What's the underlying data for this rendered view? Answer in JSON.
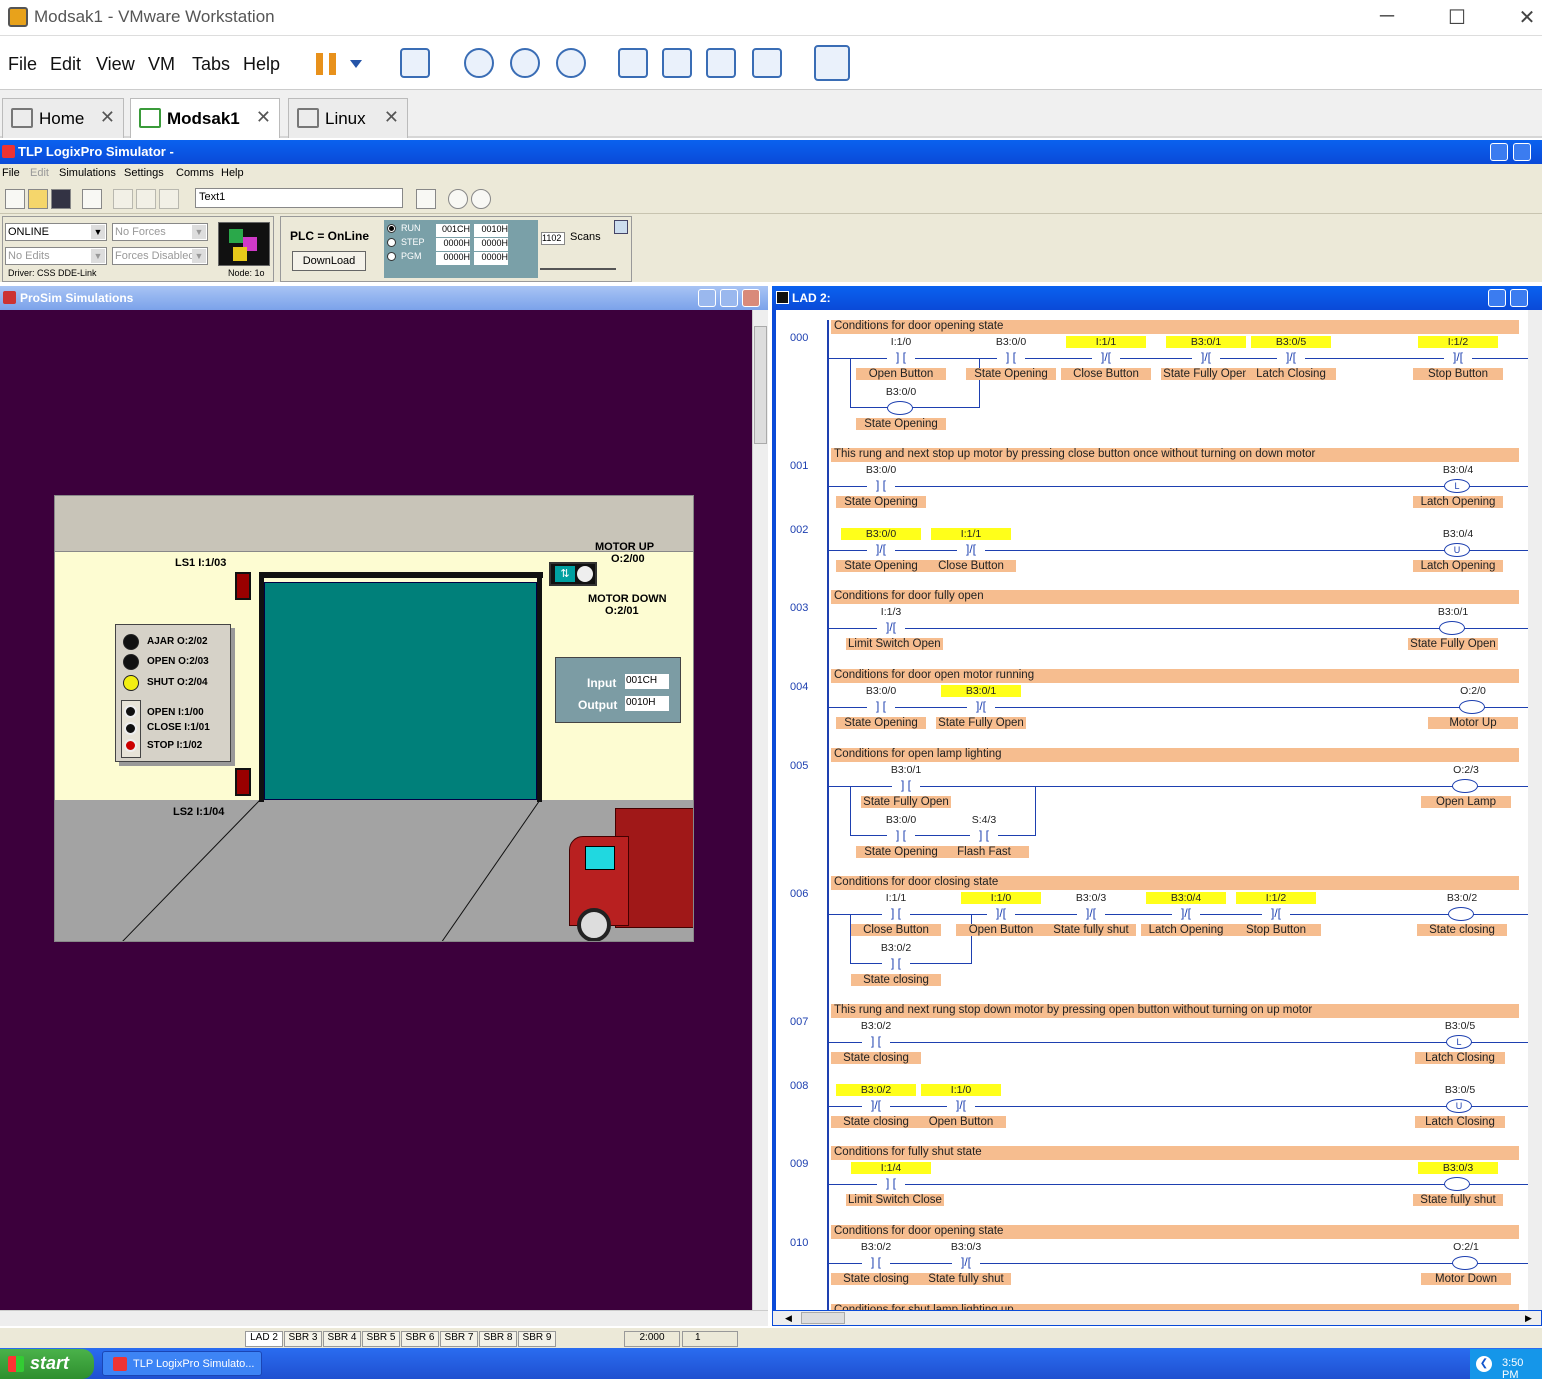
{
  "vm": {
    "title": "Modsak1 - VMware Workstation",
    "menu": [
      "File",
      "Edit",
      "View",
      "VM",
      "Tabs",
      "Help"
    ],
    "tabs": [
      {
        "label": "Home",
        "active": false
      },
      {
        "label": "Modsak1",
        "active": true
      },
      {
        "label": "Linux",
        "active": false
      }
    ]
  },
  "tlp": {
    "title": "TLP LogixPro Simulator  -",
    "menu": [
      "File",
      "Edit",
      "Simulations",
      "Settings",
      "Comms",
      "Help"
    ],
    "text_field": "Text1",
    "mode_select": "ONLINE",
    "forces_select": "No Forces",
    "edits_select": "No Edits",
    "forces_disabled_select": "Forces Disabled",
    "driver": "Driver: CSS DDE-Link",
    "node": "Node: 1o",
    "plc_status": "PLC = OnLine",
    "download_label": "DownLoad",
    "run_modes": [
      "RUN",
      "STEP",
      "PGM"
    ],
    "io_values": [
      "001CH",
      "0010H",
      "0000H",
      "0000H",
      "0000H",
      "0000H"
    ],
    "scan_count": "1102",
    "scan_label": "Scans"
  },
  "prosim": {
    "title": "ProSim Simulations",
    "ls1": "LS1  I:1/03",
    "ls2": "LS2   I:1/04",
    "motor_up": "MOTOR UP",
    "motor_up_addr": "O:2/00",
    "motor_down": "MOTOR DOWN",
    "motor_down_addr": "O:2/01",
    "lamps": [
      {
        "label": "AJAR  O:2/02",
        "color": "#111111"
      },
      {
        "label": "OPEN  O:2/03",
        "color": "#111111"
      },
      {
        "label": "SHUT  O:2/04",
        "color": "#f2ee12"
      }
    ],
    "buttons": [
      "OPEN    I:1/00",
      "CLOSE I:1/01",
      "STOP   I:1/02"
    ],
    "input_label": "Input",
    "input_value": "001CH",
    "output_label": "Output",
    "output_value": "0010H"
  },
  "lad": {
    "title": "LAD 2:",
    "rungs": [
      {
        "num": "000",
        "comment": "Conditions for door opening state"
      },
      {
        "num": "001",
        "comment": "This rung and next stop up motor by pressing close button once without turning on down motor"
      },
      {
        "num": "002",
        "comment": ""
      },
      {
        "num": "003",
        "comment": "Conditions for door fully open"
      },
      {
        "num": "004",
        "comment": "Conditions for door open motor running"
      },
      {
        "num": "005",
        "comment": "Conditions for open lamp lighting"
      },
      {
        "num": "006",
        "comment": "Conditions for door closing state"
      },
      {
        "num": "007",
        "comment": "This rung and next rung stop down motor by pressing open button without turning on up motor"
      },
      {
        "num": "008",
        "comment": ""
      },
      {
        "num": "009",
        "comment": "Conditions for fully shut state"
      },
      {
        "num": "010",
        "comment": "Conditions for door opening state"
      },
      {
        "num": "",
        "comment": "Conditions for shut lamp lighting up"
      }
    ],
    "elements": [
      {
        "addr": "I:1/0",
        "desc": "Open Button",
        "glyph": "] [",
        "hl": false
      },
      {
        "addr": "B3:0/0",
        "desc": "State Opening",
        "glyph": "] [",
        "hl": false
      },
      {
        "addr": "I:1/1",
        "desc": "Close Button",
        "glyph": "]/[",
        "hl": true
      },
      {
        "addr": "B3:0/1",
        "desc": "State Fully Open",
        "glyph": "]/[",
        "hl": true
      },
      {
        "addr": "B3:0/5",
        "desc": "Latch Closing",
        "glyph": "]/[",
        "hl": true
      },
      {
        "addr": "I:1/2",
        "desc": "Stop Button",
        "glyph": "]/[",
        "hl": true
      },
      {
        "addr": "B3:0/0",
        "desc": "State Opening",
        "glyph": "( )",
        "hl": false
      },
      {
        "addr": "B3:0/0",
        "desc": "State Opening",
        "glyph": "] [",
        "hl": false
      },
      {
        "addr": "B3:0/4",
        "desc": "Latch Opening",
        "glyph": "(L)",
        "hl": false
      },
      {
        "addr": "B3:0/0",
        "desc": "State Opening",
        "glyph": "]/[",
        "hl": true
      },
      {
        "addr": "I:1/1",
        "desc": "Close Button",
        "glyph": "]/[",
        "hl": true
      },
      {
        "addr": "B3:0/4",
        "desc": "Latch Opening",
        "glyph": "(U)",
        "hl": false
      },
      {
        "addr": "I:1/3",
        "desc": "Limit Switch Open",
        "glyph": "]/[",
        "hl": false
      },
      {
        "addr": "B3:0/1",
        "desc": "State Fully Open",
        "glyph": "( )",
        "hl": false
      },
      {
        "addr": "B3:0/0",
        "desc": "State Opening",
        "glyph": "] [",
        "hl": false
      },
      {
        "addr": "B3:0/1",
        "desc": "State Fully Open",
        "glyph": "]/[",
        "hl": true
      },
      {
        "addr": "O:2/0",
        "desc": "Motor Up",
        "glyph": "( )",
        "hl": false
      },
      {
        "addr": "B3:0/1",
        "desc": "State Fully Open",
        "glyph": "] [",
        "hl": false
      },
      {
        "addr": "B3:0/0",
        "desc": "State Opening",
        "glyph": "] [",
        "hl": false
      },
      {
        "addr": "S:4/3",
        "desc": "Flash Fast",
        "glyph": "] [",
        "hl": false
      },
      {
        "addr": "O:2/3",
        "desc": "Open Lamp",
        "glyph": "( )",
        "hl": false
      },
      {
        "addr": "I:1/1",
        "desc": "Close Button",
        "glyph": "] [",
        "hl": false
      },
      {
        "addr": "B3:0/2",
        "desc": "State closing",
        "glyph": "] [",
        "hl": false
      },
      {
        "addr": "I:1/0",
        "desc": "Open Button",
        "glyph": "]/[",
        "hl": true
      },
      {
        "addr": "B3:0/3",
        "desc": "State fully shut",
        "glyph": "]/[",
        "hl": false
      },
      {
        "addr": "B3:0/4",
        "desc": "Latch Opening",
        "glyph": "]/[",
        "hl": true
      },
      {
        "addr": "I:1/2",
        "desc": "Stop Button",
        "glyph": "]/[",
        "hl": true
      },
      {
        "addr": "B3:0/2",
        "desc": "State closing",
        "glyph": "( )",
        "hl": false
      },
      {
        "addr": "B3:0/2",
        "desc": "State closing",
        "glyph": "] [",
        "hl": false
      },
      {
        "addr": "B3:0/5",
        "desc": "Latch Closing",
        "glyph": "(L)",
        "hl": false
      },
      {
        "addr": "B3:0/2",
        "desc": "State closing",
        "glyph": "]/[",
        "hl": true
      },
      {
        "addr": "I:1/0",
        "desc": "Open Button",
        "glyph": "]/[",
        "hl": true
      },
      {
        "addr": "B3:0/5",
        "desc": "Latch Closing",
        "glyph": "(U)",
        "hl": false
      },
      {
        "addr": "I:1/4",
        "desc": "Limit Switch Close",
        "glyph": "] [",
        "hl": true
      },
      {
        "addr": "B3:0/3",
        "desc": "State fully shut",
        "glyph": "( )",
        "hl": true
      },
      {
        "addr": "B3:0/2",
        "desc": "State closing",
        "glyph": "] [",
        "hl": false
      },
      {
        "addr": "B3:0/3",
        "desc": "State fully shut",
        "glyph": "]/[",
        "hl": false
      },
      {
        "addr": "O:2/1",
        "desc": "Motor Down",
        "glyph": "( )",
        "hl": false
      }
    ]
  },
  "bottom_tabs": [
    "LAD 2",
    "SBR 3",
    "SBR 4",
    "SBR 5",
    "SBR 6",
    "SBR 7",
    "SBR 8",
    "SBR 9"
  ],
  "status_cells": [
    "2:000",
    "1"
  ],
  "taskbar": {
    "start": "start",
    "item": "TLP LogixPro Simulato...",
    "clock": "3:50 PM"
  }
}
